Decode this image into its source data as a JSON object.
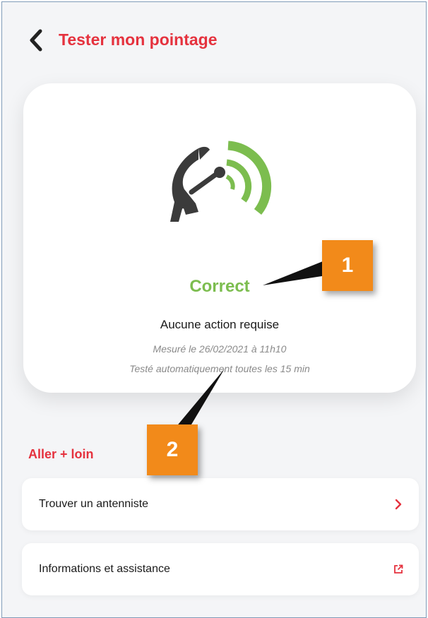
{
  "header": {
    "back_icon": "chevron-left-icon",
    "title": "Tester mon pointage"
  },
  "status_card": {
    "icon": "satellite-dish-icon",
    "status": "Correct",
    "description": "Aucune action requise",
    "measured": "Mesuré le 26/02/2021 à 11h10",
    "auto_test": "Testé automatiquement toutes les 15 min",
    "colors": {
      "status_green": "#7cbd4f",
      "dish_gray": "#3b3b3b"
    }
  },
  "section": {
    "title": "Aller + loin",
    "items": [
      {
        "label": "Trouver un antenniste",
        "icon": "chevron-right-icon"
      },
      {
        "label": "Informations et assistance",
        "icon": "external-link-icon"
      }
    ]
  },
  "annotations": {
    "callout_1": "1",
    "callout_2": "2",
    "callout_color": "#f28a1a"
  },
  "theme": {
    "accent": "#e5323e",
    "background": "#f4f5f7"
  }
}
